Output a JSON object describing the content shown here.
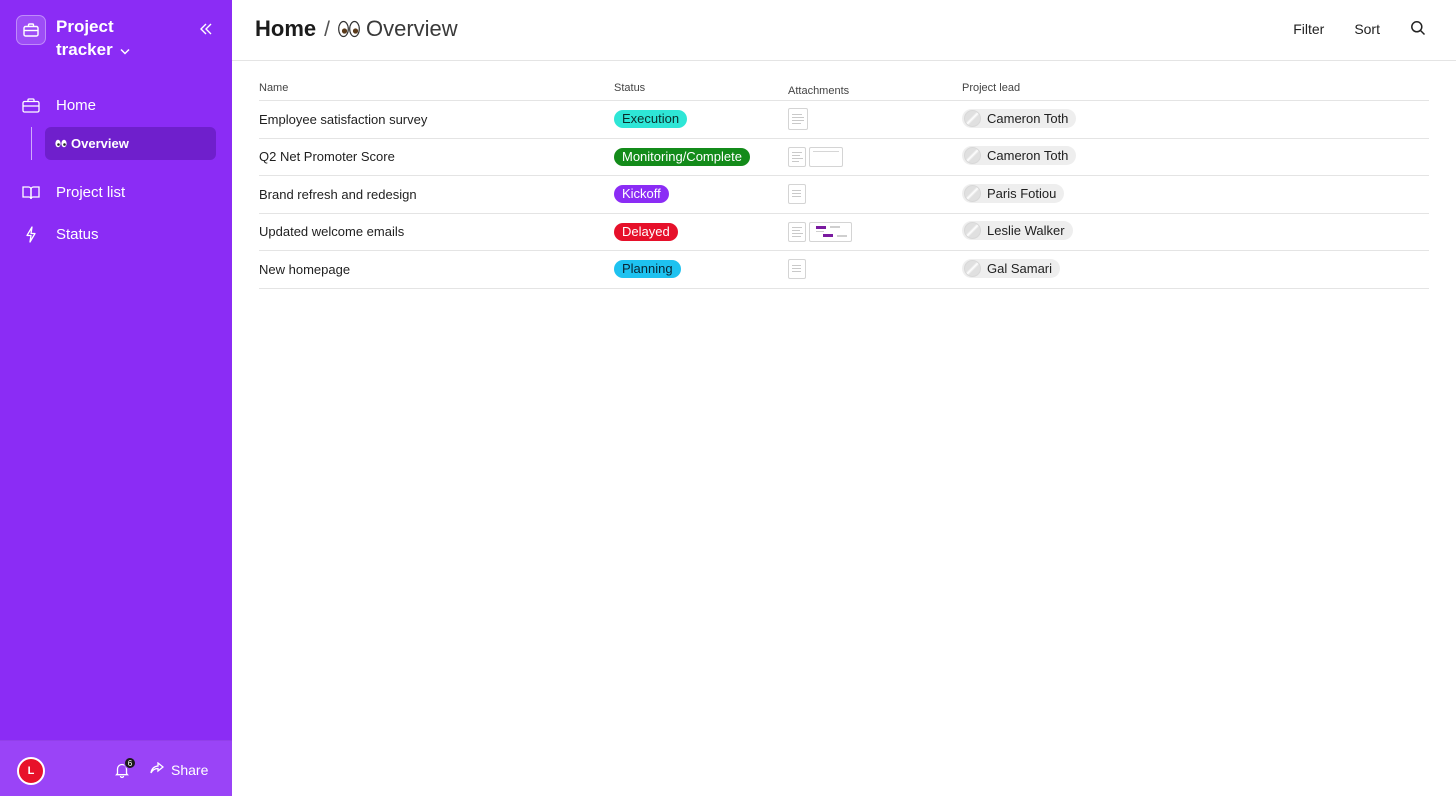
{
  "app": {
    "title": "Project tracker",
    "accent": "#8b2cf5"
  },
  "sidebar": {
    "nav": [
      {
        "label": "Home",
        "icon": "briefcase-icon"
      },
      {
        "label": "Project list",
        "icon": "book-icon"
      },
      {
        "label": "Status",
        "icon": "bolt-icon"
      }
    ],
    "sub_item": {
      "label": "Overview",
      "icon": "eyes-icon"
    }
  },
  "footer": {
    "avatar_initial": "L",
    "notifications": "6",
    "share_label": "Share"
  },
  "breadcrumb": {
    "home": "Home",
    "separator": "/",
    "current": "Overview"
  },
  "toolbar": {
    "filter_label": "Filter",
    "sort_label": "Sort"
  },
  "table": {
    "columns": [
      "Name",
      "Status",
      "Attachments",
      "Project lead"
    ],
    "rows": [
      {
        "name": "Employee satisfaction survey",
        "status": "Execution",
        "status_bg": "#2ee6d6",
        "status_fg": "#0a2e2b",
        "lead": "Cameron Toth"
      },
      {
        "name": "Q2 Net Promoter Score",
        "status": "Monitoring/Complete",
        "status_bg": "#138b1a",
        "status_fg": "#ffffff",
        "lead": "Cameron Toth"
      },
      {
        "name": "Brand refresh and redesign",
        "status": "Kickoff",
        "status_bg": "#8b2cf5",
        "status_fg": "#ffffff",
        "lead": "Paris Fotiou"
      },
      {
        "name": "Updated welcome emails",
        "status": "Delayed",
        "status_bg": "#e6102a",
        "status_fg": "#ffffff",
        "lead": "Leslie Walker"
      },
      {
        "name": "New homepage",
        "status": "Planning",
        "status_bg": "#1ec2f0",
        "status_fg": "#0a2533",
        "lead": "Gal Samari"
      }
    ]
  }
}
